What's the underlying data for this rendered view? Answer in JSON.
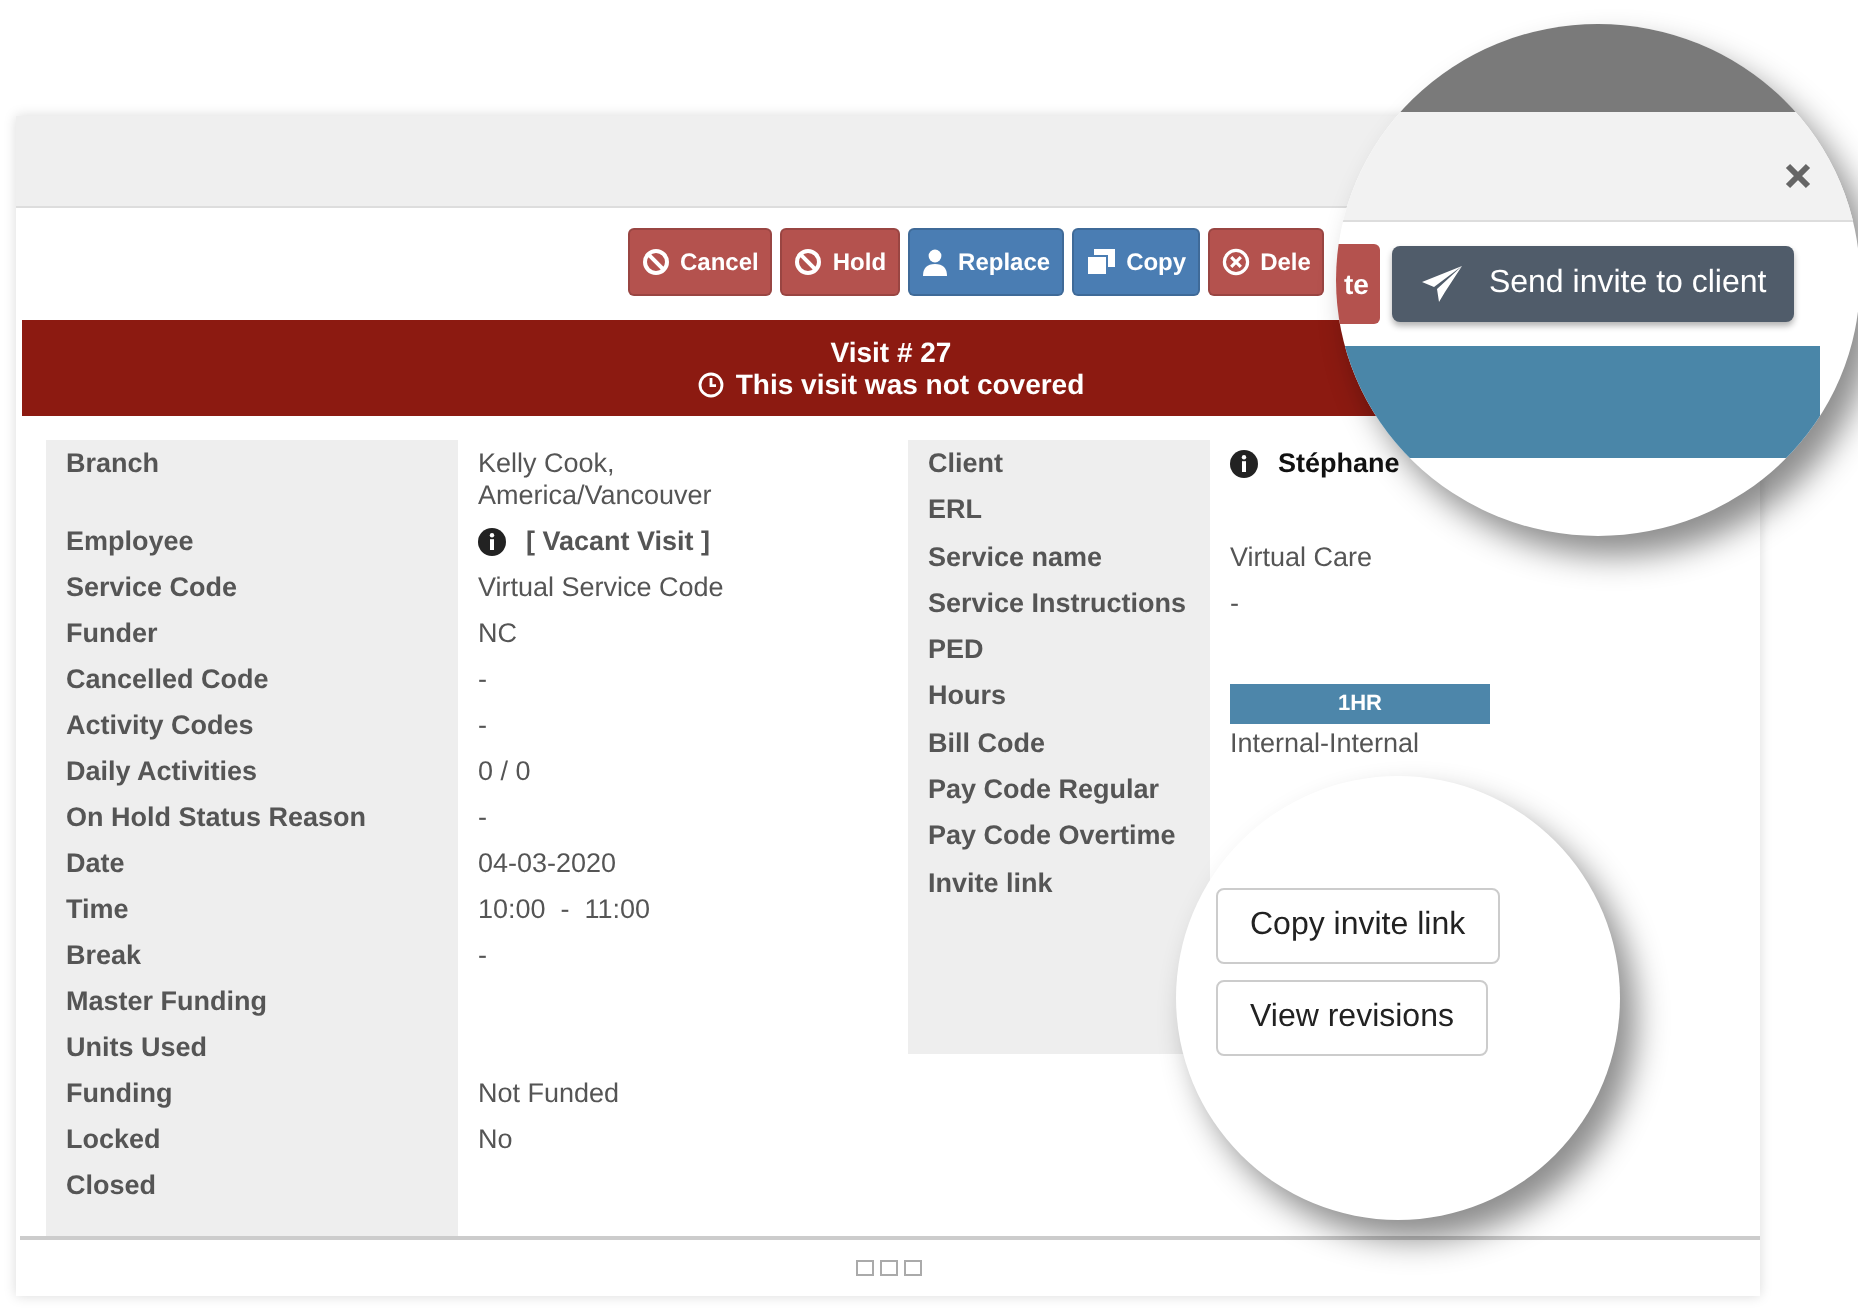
{
  "toolbar": [
    {
      "label": "Cancel",
      "kind": "ban",
      "color": "#b4524e"
    },
    {
      "label": "Hold",
      "kind": "ban",
      "color": "#b4524e"
    },
    {
      "label": "Replace",
      "kind": "user",
      "color": "#4a7db3"
    },
    {
      "label": "Copy",
      "kind": "copy",
      "color": "#4a7db3"
    },
    {
      "label": "Dele",
      "kind": "remove",
      "color": "#b4524e"
    }
  ],
  "banner": {
    "title": "Visit # 27",
    "message": "This visit was not covered"
  },
  "left_fields": [
    {
      "label": "Branch",
      "kind": "text",
      "value": "Kelly Cook,\nAmerica/Vancouver"
    },
    {
      "label": "Employee",
      "kind": "info",
      "value": "[ Vacant Visit ]"
    },
    {
      "label": "Service Code",
      "kind": "text",
      "value": "Virtual Service Code"
    },
    {
      "label": "Funder",
      "kind": "text",
      "value": "NC"
    },
    {
      "label": "Cancelled Code",
      "kind": "text",
      "value": "-"
    },
    {
      "label": "Activity Codes",
      "kind": "text",
      "value": "-"
    },
    {
      "label": "Daily Activities",
      "kind": "text",
      "value": "0 / 0"
    },
    {
      "label": "On Hold Status Reason",
      "kind": "text",
      "value": "-"
    },
    {
      "label": "Date",
      "kind": "text",
      "value": "04-03-2020"
    },
    {
      "label": "Time",
      "kind": "text",
      "value": "10:00  -  11:00"
    },
    {
      "label": "Break",
      "kind": "text",
      "value": "-"
    },
    {
      "label": "Master Funding",
      "kind": "text"
    },
    {
      "label": "Units Used",
      "kind": "text"
    },
    {
      "label": "Funding",
      "kind": "text",
      "value": "Not Funded"
    },
    {
      "label": "Locked",
      "kind": "text",
      "value": "No"
    },
    {
      "label": "Closed",
      "kind": "text"
    }
  ],
  "right_fields": [
    {
      "label": "Client",
      "kind": "info",
      "value": "Stéphane"
    },
    {
      "label": "ERL",
      "kind": "text"
    },
    {
      "label": "Service name",
      "kind": "text",
      "value": "Virtual Care"
    },
    {
      "label": "Service Instructions",
      "kind": "text",
      "value": "-"
    },
    {
      "label": "PED",
      "kind": "text"
    },
    {
      "label": "Hours",
      "kind": "badge",
      "value": "1HR"
    },
    {
      "label": "Bill Code",
      "kind": "text",
      "value": "Internal-Internal"
    },
    {
      "label": "Pay Code Regular",
      "kind": "text"
    },
    {
      "label": "Pay Code Overtime",
      "kind": "text"
    },
    {
      "label": "Invite link",
      "kind": "text"
    }
  ],
  "magnifier_top": {
    "delete_fragment": "te",
    "send_button": "Send invite to client"
  },
  "magnifier_bottom": {
    "buttons": [
      "Copy invite link",
      "View revisions"
    ]
  }
}
